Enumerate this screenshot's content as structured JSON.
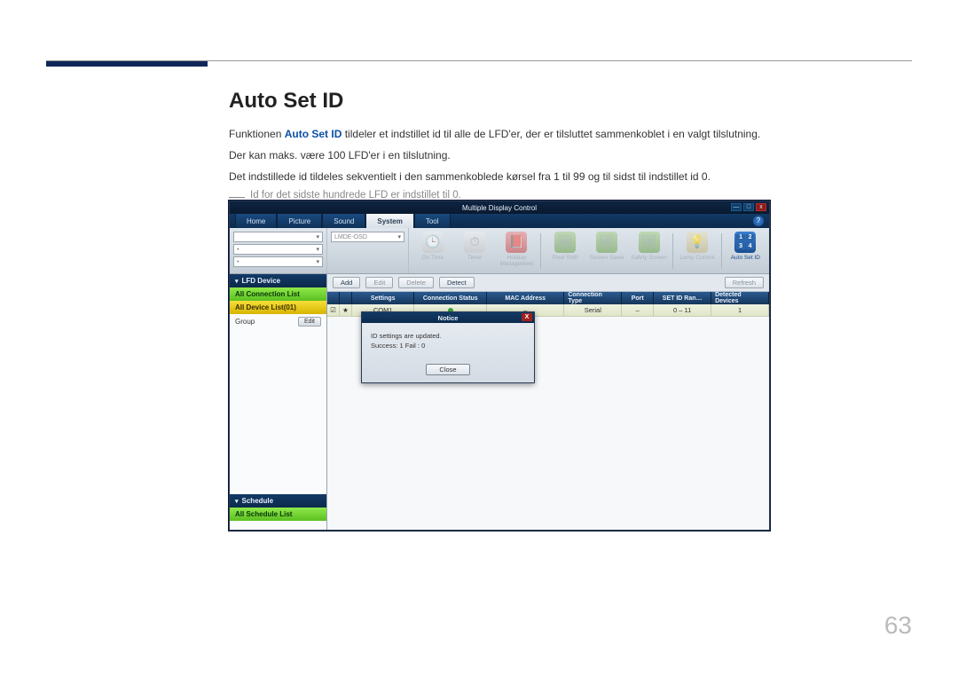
{
  "page": {
    "heading": "Auto Set ID",
    "para1_pre": "Funktionen ",
    "para1_kw": "Auto Set ID",
    "para1_post": " tildeler et indstillet id til alle de LFD'er, der er tilsluttet sammenkoblet i en valgt tilslutning.",
    "para2": "Der kan maks. være 100 LFD'er i en tilslutning.",
    "para3": "Det indstillede id tildeles sekventielt i den sammenkoblede kørsel fra 1 til 99 og til sidst til indstillet id 0.",
    "note": "Id for det sidste hundrede LFD er indstillet til 0.",
    "number": "63"
  },
  "app": {
    "title": "Multiple Display Control",
    "win": {
      "min": "—",
      "max": "□",
      "close": "x"
    },
    "tabs": {
      "home": "Home",
      "picture": "Picture",
      "sound": "Sound",
      "system": "System",
      "tool": "Tool"
    },
    "help": "?",
    "combo1": "",
    "combo2": "LMDE-OSD",
    "ticon": {
      "clock": "On Time",
      "timer": "Timer",
      "holiday": "Holiday Management",
      "pixel": "Pixel Shift",
      "saver": "Screen Saver",
      "safety": "Safety Screen",
      "lamp": "Lamp Control",
      "auto": "Auto Set ID",
      "auto_grid": [
        "1",
        "2",
        "3",
        "4"
      ]
    },
    "sidebar": {
      "lfd": "LFD Device",
      "all_conn": "All Connection List",
      "all_dev": "All Device List(01)",
      "group": "Group",
      "edit": "Edit",
      "schedule": "Schedule",
      "all_sched": "All Schedule List"
    },
    "actions": {
      "add": "Add",
      "edit": "Edit",
      "delete": "Delete",
      "detect": "Detect",
      "refresh": "Refresh"
    },
    "thead": {
      "settings": "Settings",
      "conn": "Connection Status",
      "mac": "MAC Address",
      "type": "Connection Type",
      "port": "Port",
      "range": "SET ID Ran…",
      "det": "Detected Devices"
    },
    "row": {
      "settings": "COM1",
      "mac": "–",
      "type": "Serial",
      "port": "–",
      "range": "0 – 11",
      "det": "1"
    },
    "modal": {
      "title": "Notice",
      "line1": "ID settings are updated.",
      "line2": "Success: 1  Fail : 0",
      "close": "Close",
      "x": "X"
    }
  }
}
